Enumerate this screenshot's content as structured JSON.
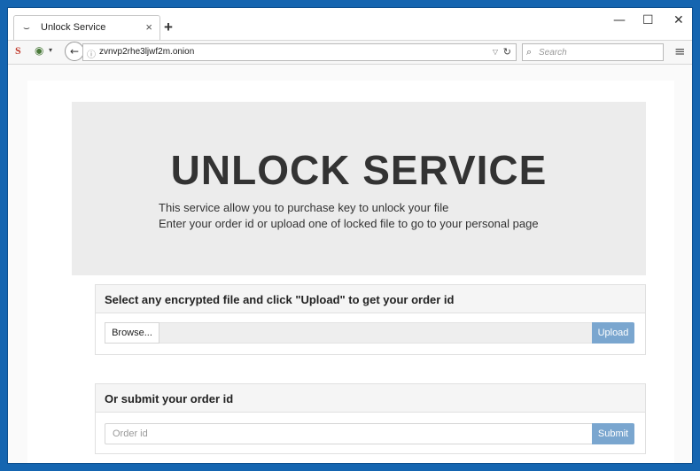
{
  "browser": {
    "tab": {
      "icon": "tor-loading-icon",
      "title": "Unlock Service",
      "close_glyph": "×"
    },
    "new_tab_glyph": "+",
    "window_controls": {
      "minimize": "—",
      "maximize": "☐",
      "close": "✕"
    },
    "toolbar": {
      "s_button": "S",
      "onion_glyph": "◉",
      "onion_caret": "▾",
      "back_glyph": "←",
      "info_glyph": "ⓘ",
      "url": "zvnvp2rhe3ljwf2m.onion",
      "url_dropdown_glyph": "▽",
      "reload_glyph": "↻",
      "search_glyph": "⌕",
      "search_placeholder": "Search",
      "menu_glyph": "≡"
    }
  },
  "page": {
    "title": "UNLOCK SERVICE",
    "intro_line1": "This service allow you to purchase key to unlock your file",
    "intro_line2": "Enter your order id or upload one of locked file to go to your personal page",
    "upload_panel": {
      "heading": "Select any encrypted file and click \"Upload\" to get your order id",
      "browse_label": "Browse...",
      "upload_label": "Upload"
    },
    "order_panel": {
      "heading": "Or submit your order id",
      "input_placeholder": "Order id",
      "submit_label": "Submit"
    }
  },
  "colors": {
    "frame_blue": "#1565b0",
    "button_blue": "#7aa6cf",
    "jumbotron_gray": "#ececec"
  }
}
